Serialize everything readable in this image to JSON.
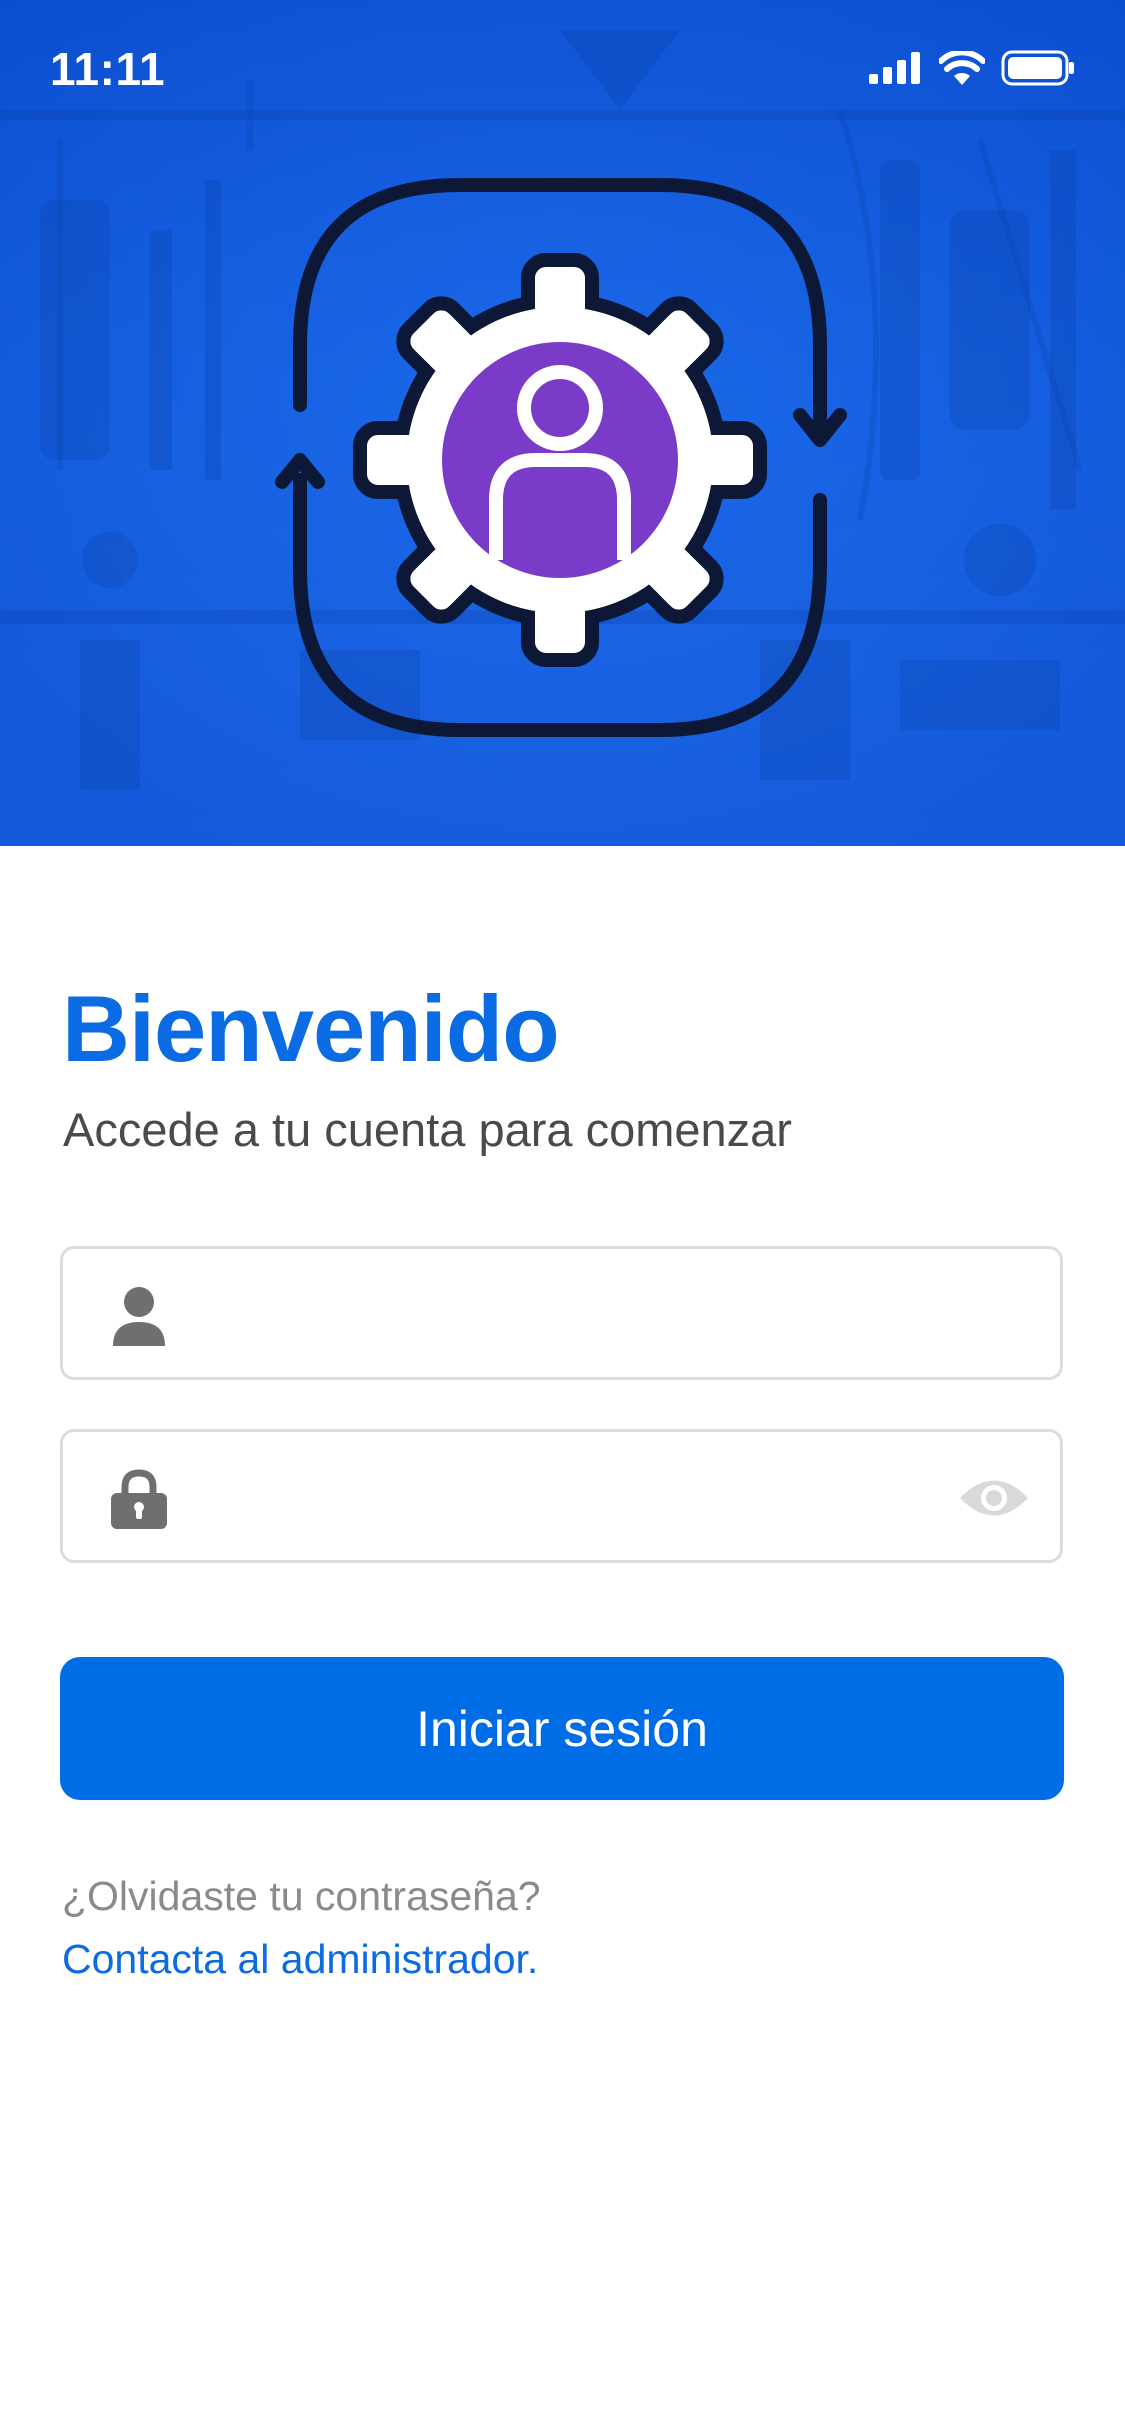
{
  "status_bar": {
    "time": "11:11",
    "icons": [
      "cellular-signal-icon",
      "wifi-icon",
      "battery-icon"
    ]
  },
  "hero": {
    "logo_icon": "user-gear-sync-icon",
    "background_color": "#1262e6",
    "logo_accent_color": "#7b3bc9"
  },
  "login": {
    "title": "Bienvenido",
    "subtitle": "Accede a tu cuenta para comenzar",
    "username": {
      "icon": "user-icon",
      "value": "",
      "placeholder": ""
    },
    "password": {
      "icon": "lock-icon",
      "toggle_icon": "eye-icon",
      "value": "",
      "placeholder": ""
    },
    "submit_label": "Iniciar sesión",
    "forgot_text": "¿Olvidaste tu contraseña?",
    "contact_link": "Contacta al administrador."
  },
  "colors": {
    "primary": "#006ce5",
    "title": "#0a6be3",
    "muted_text": "#8a8a8a",
    "border": "#dcdcdc"
  }
}
